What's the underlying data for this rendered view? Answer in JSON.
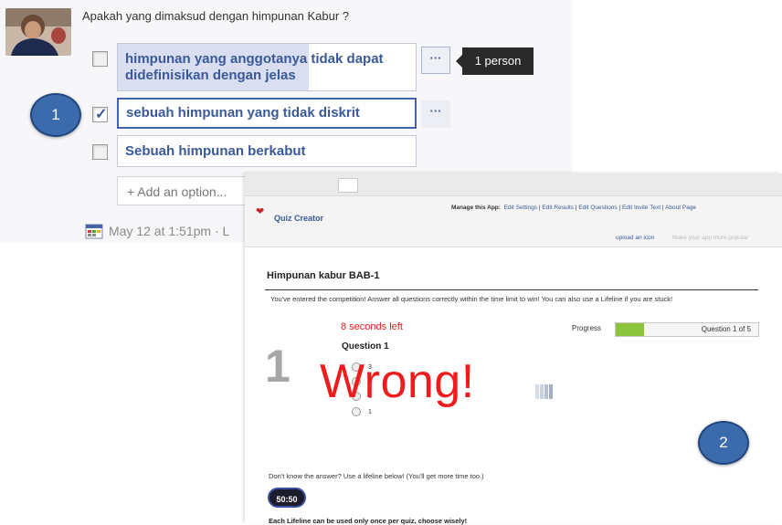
{
  "question": "Apakah yang dimaksud dengan himpunan Kabur ?",
  "options": [
    {
      "label": "himpunan yang anggotanya tidak dapat didefinisikan dengan jelas",
      "checked": false,
      "vote_fraction": 0.64
    },
    {
      "label": "sebuah himpunan yang tidak diskrit",
      "checked": true,
      "vote_fraction": 0
    },
    {
      "label": "Sebuah himpunan berkabut",
      "checked": false,
      "vote_fraction": 0
    }
  ],
  "more_button_label": "···",
  "tooltip": "1 person",
  "add_option_placeholder": "+ Add an option...",
  "timestamp": "May 12 at 1:51pm · L",
  "markers": [
    "1",
    "2"
  ],
  "quiz": {
    "app_name": "Quiz Creator",
    "manage_label": "Manage this App:",
    "manage_links": [
      "Edit Settings",
      "Edit Results",
      "Edit Questions",
      "Edit Invite Text",
      "About Page"
    ],
    "upload_link": "upload an icon",
    "promo_text": "Make your app more popular",
    "title": "Himpunan kabur BAB-1",
    "intro": "You've entered the competition! Answer all questions correctly within the time limit to win! You can also use a Lifeline if you are stuck!",
    "timer": "8 seconds left",
    "progress_label": "Progress",
    "progress_fraction": 0.2,
    "progress_text": "Question 1 of 5",
    "question_number": "1",
    "question_label": "Question 1",
    "answers": [
      "3",
      "2",
      "3",
      "1"
    ],
    "wrong_text": "Wrong!",
    "lifeline_text": "Don't know the answer? Use a lifeline below! (You'll get more time too.)",
    "fifty_fifty": "50:50",
    "once_text": "Each Lifeline can be used only once per quiz, choose wisely!"
  },
  "colors": {
    "fb_blue": "#3b5998",
    "marker_blue": "#3c6bad",
    "wrong_red": "#ee1c1c",
    "progress_green": "#8cc43d"
  }
}
